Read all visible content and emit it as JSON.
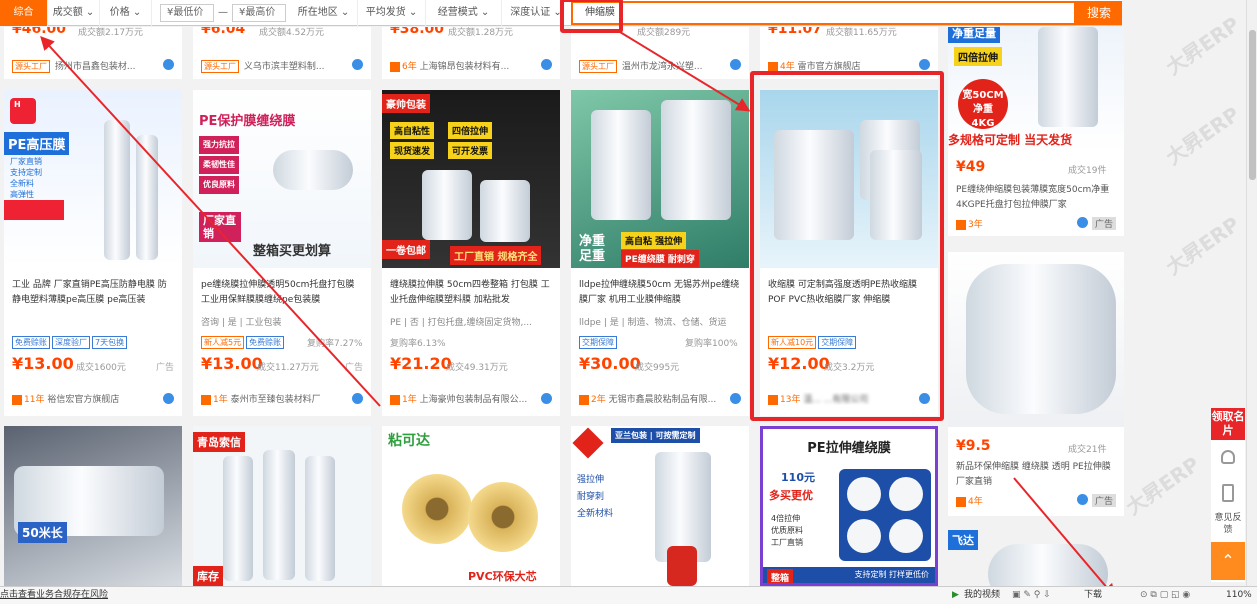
{
  "filter_bar": {
    "sort_default": "综合",
    "sort_sales": "成交额 ⌄",
    "sort_price": "价格 ⌄",
    "price_min_placeholder": "¥最低价",
    "price_dash": "—",
    "price_max_placeholder": "¥最高价",
    "location": "所在地区 ⌄",
    "delivery": "平均发货 ⌄",
    "business_mode": "经营模式 ⌄",
    "certified": "深度认证 ⌄",
    "search_value": "伸缩膜",
    "search_button": "搜索"
  },
  "top_row": [
    {
      "price": "¥46.00",
      "sold": "成交额2.17万元",
      "badge": "源头工厂",
      "shop": "扬州市昌鑫包装材...",
      "years": ""
    },
    {
      "price": "¥6.04",
      "sold": "成交额4.52万元",
      "badge": "源头工厂",
      "shop": "义乌市滨丰塑料制...",
      "years": ""
    },
    {
      "price": "¥38.00",
      "sold": "成交额1.28万元",
      "badge": "",
      "shop": "上海锦昂包装材料有...",
      "years": "6年"
    },
    {
      "price": "",
      "sold": "成交额289元",
      "badge": "源头工厂",
      "shop": "温州市龙湾永兴塑...",
      "years": ""
    },
    {
      "price": "¥11.07",
      "sold": "成交额11.65万元",
      "badge": "",
      "shop": "雷市官方旗舰店",
      "years": "4年"
    }
  ],
  "row1": [
    {
      "img_text": [
        "PE高压膜",
        "厂家直销",
        "支持定制",
        "全新料",
        "高弹性"
      ],
      "title": "工业 品牌 厂家直销PE高压防静电膜 防静电塑料薄膜pe高压膜 pe高压装",
      "subtitle": "",
      "chips": [
        "免费赊账",
        "深度验厂",
        "7天包换"
      ],
      "price": "¥13.00",
      "sold": "成交1600元",
      "ad": "广告",
      "years": "11年",
      "shop": "裕信宏官方旗舰店"
    },
    {
      "img_text": [
        "PE保护膜缠绕膜",
        "强力抗拉",
        "柔韧性佳",
        "优良原料",
        "厂家直销",
        "整箱买更划算"
      ],
      "title": "pe缠绕膜拉伸膜透明50cm托盘打包膜 工业用保鲜膜膜缠绕pe包装膜",
      "subtitle": "咨询 | 是 | 工业包装",
      "chips": [
        "新人减5元",
        "免费赊账"
      ],
      "price": "¥13.00",
      "sold": "成交11.27万元",
      "rate": "复购率7.27%",
      "ad": "广告",
      "years": "1年",
      "shop": "泰州市至臻包装材料厂"
    },
    {
      "img_text": [
        "豪帅包装",
        "高自粘性",
        "四倍拉伸",
        "现货速发",
        "可开发票",
        "一卷包邮",
        "工厂直销 规格齐全"
      ],
      "title": "缠绕膜拉伸膜 50cm四卷整箱 打包膜 工业托盘伸缩膜塑料膜 加粘批发",
      "subtitle": "PE | 否 | 打包托盘,缠绕固定货物,...",
      "chips": [],
      "price": "¥21.20",
      "sold": "成交49.31万元",
      "rate": "复购率6.13%",
      "ad": "",
      "years": "1年",
      "shop": "上海豪帅包装制品有限公..."
    },
    {
      "img_text": [
        "净重足重",
        "高自粘 强拉伸",
        "PE缠绕膜 耐刺穿"
      ],
      "title": "lldpe拉伸缠绕膜50cm 无锡苏州pe缠绕膜厂家 机用工业膜伸缩膜",
      "subtitle": "lldpe | 是 | 制造、物流、仓储、货运",
      "chips": [
        "交期保障"
      ],
      "price": "¥30.00",
      "sold": "成交995元",
      "rate": "复购率100%",
      "ad": "",
      "years": "2年",
      "shop": "无锡市鑫晨胶粘制品有限..."
    },
    {
      "img_text": [],
      "title": "收缩膜 可定制高强度透明PE热收缩膜 POF PVC热收缩膜厂家 伸缩膜",
      "subtitle": "",
      "chips": [
        "新人减10元",
        "交期保障"
      ],
      "price": "¥12.00",
      "sold": "成交3.2万元",
      "ad": "",
      "years": "13年",
      "shop": "温... ...有限公司"
    }
  ],
  "right_col": [
    {
      "img_text": [
        "净重足量",
        "四倍拉伸",
        "宽50CM",
        "净重4KG",
        "多规格可定制 当天发货"
      ],
      "price": "¥49",
      "sold": "成交19件",
      "title": "PE缠绕伸缩膜包装薄膜宽度50cm净重4KGPE托盘打包拉伸膜厂家",
      "years": "3年",
      "ad": "广告"
    },
    {
      "img_text": [],
      "price": "¥9.5",
      "sold": "成交21件",
      "title": "新品环保伸缩膜 缠绕膜 透明 PE拉伸膜 厂家直销",
      "years": "4年",
      "ad": "广告"
    }
  ],
  "row2": [
    {
      "img_text": [
        "50米长"
      ]
    },
    {
      "img_text": [
        "青岛索信",
        "库存"
      ]
    },
    {
      "img_text": [
        "粘可达",
        "PVC环保大芯"
      ]
    },
    {
      "img_text": [
        "亚兰包装 | 可按需定制",
        "强拉伸",
        "耐穿刺",
        "全新材料"
      ]
    },
    {
      "img_text": [
        "PE拉伸缠绕膜",
        "110元",
        "多买更优",
        "4倍拉伸",
        "优质原料",
        "工厂直销",
        "支持定制 打样更低价",
        "整箱"
      ]
    },
    {
      "img_text": [
        "飞达"
      ]
    }
  ],
  "sidebar": {
    "top_label": "领取名片",
    "feedback": "意见反馈"
  },
  "status_bar": {
    "left": "点击查看业务合规存在风险",
    "video": "我的视频",
    "download": "下载",
    "zoom": "110%"
  },
  "watermark": "大昇ERP",
  "colors": {
    "accent": "#ff6a00",
    "price": "#ff4400",
    "annotation": "#e8262a"
  }
}
